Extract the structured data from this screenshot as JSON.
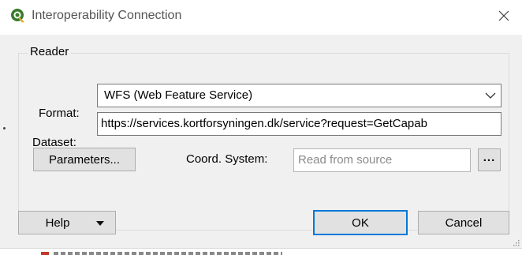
{
  "window": {
    "title": "Interoperability Connection",
    "app_icon": "qgis-icon",
    "close_icon": "close-icon"
  },
  "reader": {
    "group_title": "Reader",
    "format_label": "Format:",
    "format_value": "WFS (Web Feature Service)",
    "format_dropdown_icon": "chevron-down-icon",
    "dataset_label": "Dataset:",
    "dataset_value": "https://services.kortforsyningen.dk/service?request=GetCapab",
    "parameters_button": "Parameters...",
    "coord_label": "Coord. System:",
    "coord_placeholder": "Read from source",
    "coord_browse_button": "..."
  },
  "footer": {
    "help_button": "Help",
    "help_dropdown_icon": "caret-down-icon",
    "ok_button": "OK",
    "cancel_button": "Cancel"
  },
  "colors": {
    "dialog_bg": "#f0f0f0",
    "default_button_border": "#0078d7",
    "button_bg": "#e1e1e1",
    "placeholder_text": "#8a8a8a"
  }
}
